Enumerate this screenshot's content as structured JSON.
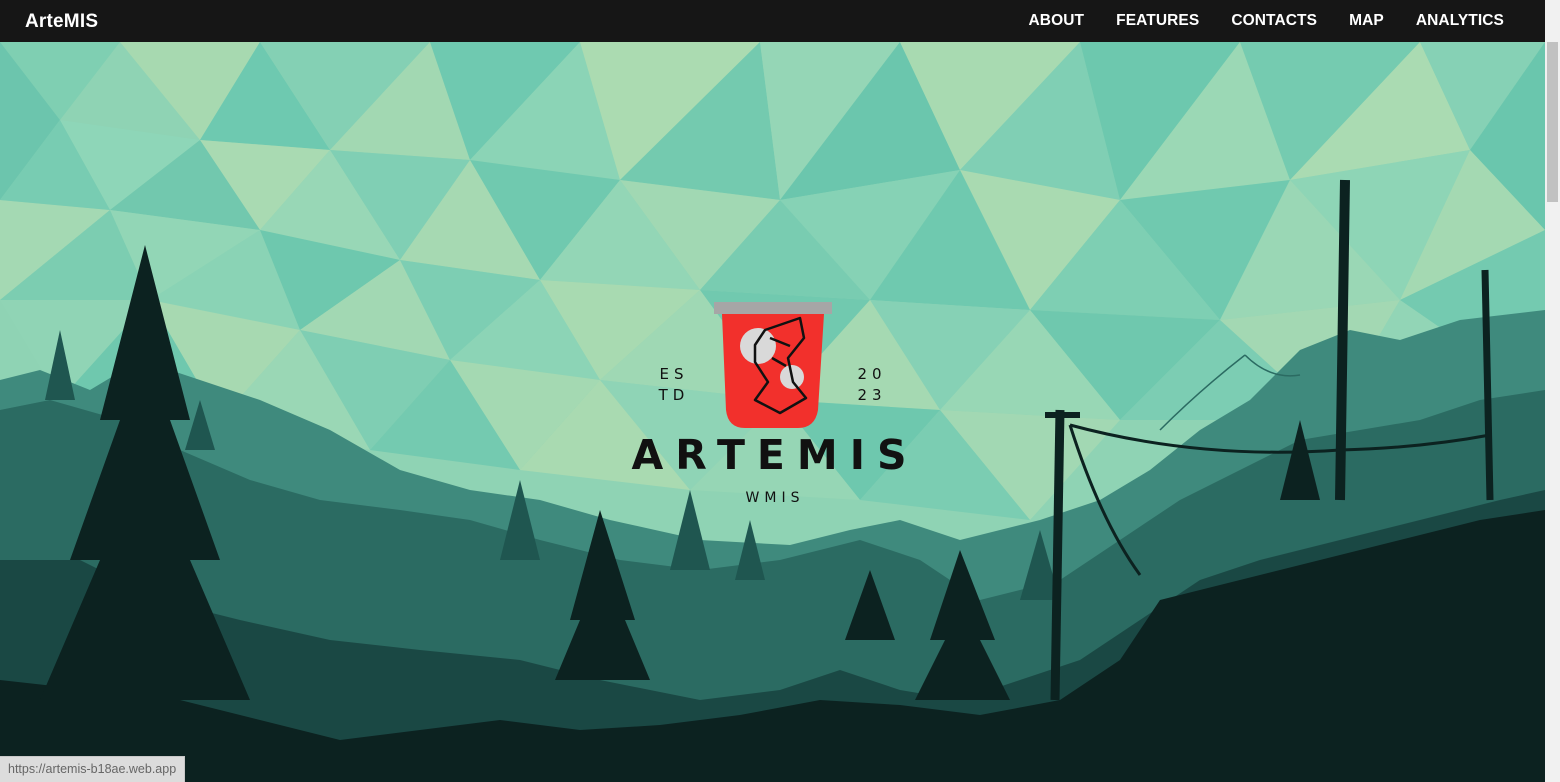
{
  "navbar": {
    "brand": "ArteMIS",
    "links": [
      {
        "label": "ABOUT"
      },
      {
        "label": "FEATURES"
      },
      {
        "label": "CONTACTS"
      },
      {
        "label": "MAP"
      },
      {
        "label": "ANALYTICS"
      }
    ]
  },
  "hero": {
    "logo": {
      "est_left_1": "ES",
      "est_left_2": "TD",
      "est_right_1": "20",
      "est_right_2": "23",
      "title": "ARTEMIS",
      "subtitle": "WMIS"
    }
  },
  "status_bar": {
    "url": "https://artemis-b18ae.web.app"
  },
  "colors": {
    "navbar_bg": "#161616",
    "sky_light": "#a6d8b0",
    "sky_teal": "#6ec8b0",
    "logo_red": "#f2302c",
    "dark_silhouette": "#0c2220"
  }
}
